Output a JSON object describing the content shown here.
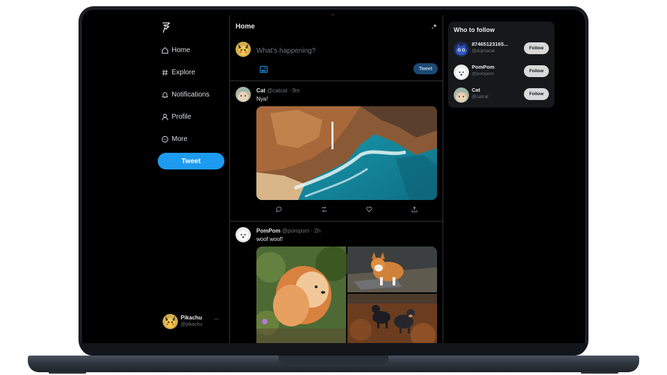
{
  "theme": {
    "accent": "#1d9bf0",
    "background": "#000000",
    "border": "#2f3336",
    "muted_text": "#71767b"
  },
  "sidebar": {
    "logo_icon": "feather-logo-icon",
    "items": [
      {
        "label": "Home",
        "icon": "home-icon"
      },
      {
        "label": "Explore",
        "icon": "hash-icon"
      },
      {
        "label": "Notifications",
        "icon": "bell-icon"
      },
      {
        "label": "Profile",
        "icon": "user-icon"
      },
      {
        "label": "More",
        "icon": "more-circle-icon"
      }
    ],
    "tweet_button": "Tweet",
    "account": {
      "name": "Pikachu",
      "handle": "@pikachu",
      "more": "···"
    }
  },
  "timeline": {
    "title": "Home",
    "composer": {
      "placeholder": "What's happening?",
      "button": "Tweet"
    },
    "posts": [
      {
        "name": "Cat",
        "handle": "@catcat",
        "dot": "·",
        "time": "9m",
        "text": "Nya!"
      },
      {
        "name": "PomPom",
        "handle": "@pompom",
        "dot": "·",
        "time": "2h",
        "text": "woof woof!"
      }
    ]
  },
  "who_to_follow": {
    "title": "Who to follow",
    "users": [
      {
        "name": "87465123165...",
        "handle": "@dupcacat",
        "button": "Follow"
      },
      {
        "name": "PomPom",
        "handle": "@pompom",
        "button": "Follow"
      },
      {
        "name": "Cat",
        "handle": "@catcat",
        "button": "Follow"
      }
    ]
  }
}
